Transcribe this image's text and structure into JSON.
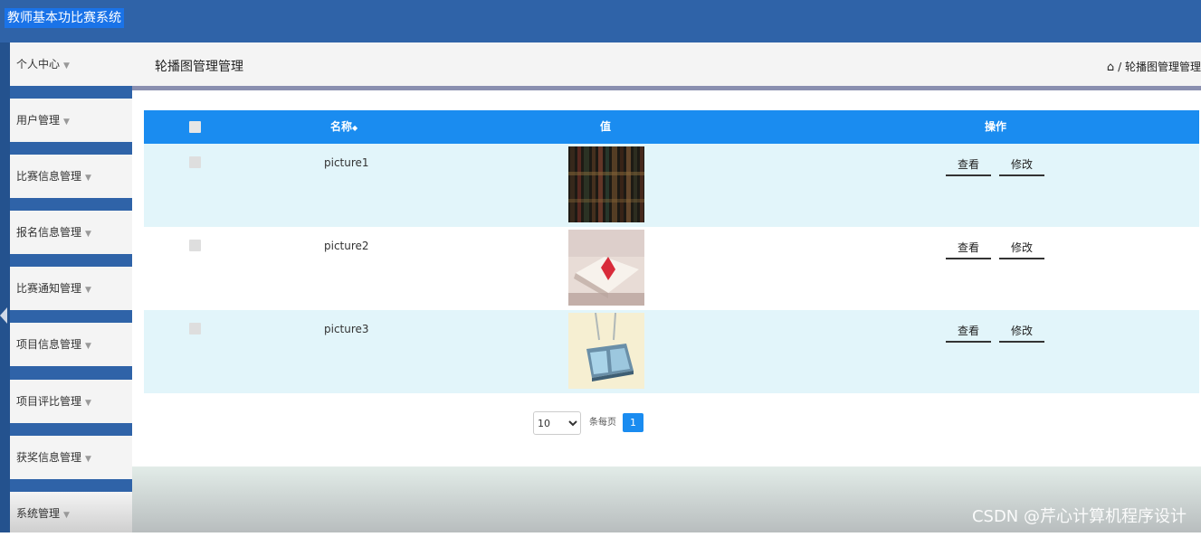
{
  "app": {
    "title": "教师基本功比赛系统"
  },
  "sidebar": {
    "items": [
      {
        "label": "个人中心"
      },
      {
        "label": "用户管理"
      },
      {
        "label": "比赛信息管理"
      },
      {
        "label": "报名信息管理"
      },
      {
        "label": "比赛通知管理"
      },
      {
        "label": "项目信息管理"
      },
      {
        "label": "项目评比管理"
      },
      {
        "label": "获奖信息管理"
      },
      {
        "label": "系统管理"
      }
    ],
    "caret_icon": "caret-down-icon"
  },
  "main": {
    "page_title": "轮播图管理管理",
    "breadcrumb": {
      "home_icon": "home-icon",
      "separator": "/",
      "current": "轮播图管理管理"
    }
  },
  "table": {
    "columns": {
      "name": "名称",
      "sort_icon": "◆",
      "value": "值",
      "actions": "操作"
    },
    "rows": [
      {
        "name": "picture1",
        "image": "dark-bookshelf-image",
        "view_label": "查看",
        "edit_label": "修改"
      },
      {
        "name": "picture2",
        "image": "open-book-image",
        "view_label": "查看",
        "edit_label": "修改"
      },
      {
        "name": "picture3",
        "image": "book-illustration-image",
        "view_label": "查看",
        "edit_label": "修改"
      }
    ]
  },
  "pagination": {
    "page_size": "10",
    "page_size_options": [
      "10"
    ],
    "per_page_label": "条每页",
    "current_page": "1"
  },
  "watermark": "CSDN @芹心计算机程序设计",
  "colors": {
    "header": "#2f63a8",
    "table_header": "#1a8cf0",
    "row_highlight": "#e2f5fa"
  }
}
